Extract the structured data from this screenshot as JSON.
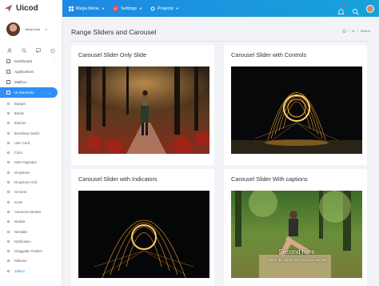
{
  "app": {
    "name": "Uicod"
  },
  "topbar": {
    "menus": [
      {
        "label": "Mega Menu"
      },
      {
        "label": "Settings",
        "badge": "4"
      },
      {
        "label": "Projects"
      }
    ]
  },
  "user": {
    "name": "Johan Doe"
  },
  "sidebar": {
    "items": [
      {
        "label": "Dashboard"
      },
      {
        "label": "Applications"
      },
      {
        "label": "Mailbox"
      },
      {
        "label": "UI Elements"
      }
    ],
    "subitems": [
      "Badges",
      "Border",
      "Buttons",
      "Bootstrap Switch",
      "User Card",
      "Color",
      "Date Paginator",
      "Dropdown",
      "Dropdown Grid",
      "General",
      "Icons",
      "Advanced Medias",
      "Modals",
      "Nestable",
      "Notification",
      "Draggable Portlets",
      "Ribbons",
      "Sliders"
    ]
  },
  "page": {
    "title": "Range Sliders and Carousel",
    "breadcrumb": [
      "UI",
      "Sliders"
    ]
  },
  "cards": [
    {
      "title": "Carousel Slider Only Slide"
    },
    {
      "title": "Carousel Slider with Controls"
    },
    {
      "title": "Carousel Slider with Indicators"
    },
    {
      "title": "Carousel Slider With captions",
      "caption_heading": "Second here",
      "caption_text": "This is the subcontent you can use this"
    }
  ],
  "colors": {
    "accent": "#2f8ff5",
    "topbar": "#1e88e5"
  }
}
